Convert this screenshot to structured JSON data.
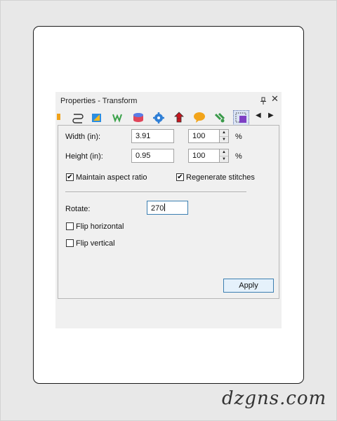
{
  "panel": {
    "title": "Properties - Transform",
    "pin_icon": "pin-icon",
    "close_label": "✕"
  },
  "toolbar": {
    "icons": [
      "partial-icon",
      "loop-icon",
      "shape-icon",
      "stitch-w-icon",
      "color-cup-icon",
      "gear-icon",
      "red-stitch-icon",
      "speech-icon",
      "green-node-icon",
      "transform-icon"
    ],
    "active_icon": "transform-icon",
    "prev_label": "◀",
    "next_label": "▶"
  },
  "transform": {
    "width_label": "Width (in):",
    "width_value": "3.91",
    "width_percent": "100",
    "height_label": "Height (in):",
    "height_value": "0.95",
    "height_percent": "100",
    "percent_sign": "%",
    "maintain_aspect_label": "Maintain aspect ratio",
    "maintain_aspect_checked": true,
    "regenerate_label": "Regenerate stitches",
    "regenerate_checked": true,
    "rotate_label": "Rotate:",
    "rotate_value": "270",
    "flip_horizontal_label": "Flip horizontal",
    "flip_horizontal_checked": false,
    "flip_vertical_label": "Flip vertical",
    "flip_vertical_checked": false,
    "apply_label": "Apply",
    "check_mark": "✔"
  },
  "watermark": "dzgns.com"
}
